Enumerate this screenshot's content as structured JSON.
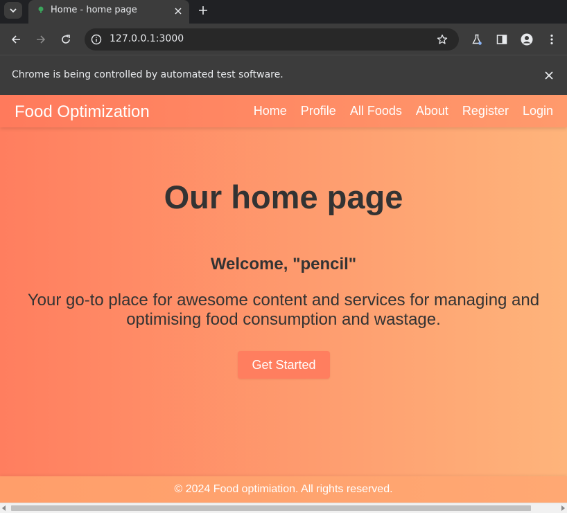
{
  "browser": {
    "tab_title": "Home - home page",
    "url": "127.0.0.1:3000",
    "infobar_text": "Chrome is being controlled by automated test software."
  },
  "page": {
    "brand": "Food Optimization",
    "nav": [
      "Home",
      "Profile",
      "All Foods",
      "About",
      "Register",
      "Login"
    ],
    "hero_title": "Our home page",
    "welcome": "Welcome, \"pencil\"",
    "tagline": "Your go-to place for awesome content and services for managing and optimising food consumption and wastage.",
    "cta_label": "Get Started",
    "footer": "© 2024 Food optimiation. All rights reserved."
  },
  "colors": {
    "gradient_start": "#ff7e5f",
    "gradient_end": "#feb47b",
    "text": "#333333",
    "button": "#ff7e5f"
  },
  "icons": [
    "chevron-down-icon",
    "favicon-icon",
    "close-icon",
    "plus-icon",
    "back-icon",
    "forward-icon",
    "reload-icon",
    "info-icon",
    "star-icon",
    "labs-icon",
    "side-panel-icon",
    "profile-icon",
    "more-icon"
  ]
}
